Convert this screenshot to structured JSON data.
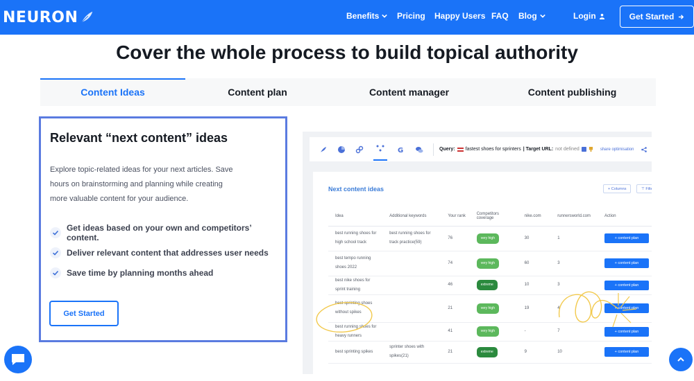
{
  "nav": {
    "logo": "NEURON",
    "links": [
      "Benefits",
      "Pricing",
      "Happy Users",
      "FAQ",
      "Blog"
    ],
    "login": "Login",
    "cta": "Get Started"
  },
  "heading": "Cover the whole process to build topical authority",
  "tabs": [
    "Content Ideas",
    "Content plan",
    "Content manager",
    "Content publishing"
  ],
  "card": {
    "title": "Relevant “next content” ideas",
    "desc_lines": [
      "Explore topic-related ideas for your next articles. Save",
      "hours on brainstorming and planning while creating",
      "more valuable content for your audience."
    ],
    "bullets": [
      "Get ideas based on your own and competitors’ content.",
      "Deliver relevant content that addresses user needs",
      "Save time by planning months ahead"
    ],
    "button": "Get Started"
  },
  "preview": {
    "toolbar": {
      "query_label": "Query:",
      "query_value": "fastest shoes for sprinters",
      "target_label": "| Target URL:",
      "target_value": "not defined",
      "share": "share optimisation"
    },
    "panel_title": "Next content ideas",
    "columns_btn": "+ Columns",
    "filters_btn": "⊤ Filters",
    "table": {
      "headers": [
        "Idea",
        "Additional keywords",
        "Your rank",
        "Competitors coverage",
        "nike.com",
        "runnersworld.com",
        "Action"
      ],
      "rows": [
        {
          "idea": "best running shoes for high school track",
          "keywords": "best running shoes for track practice(59)",
          "rank": "76",
          "coverage": "very high",
          "cov_type": "vh",
          "nike": "30",
          "rw": "1",
          "action": "+ content plan"
        },
        {
          "idea": "best tempo running shoes 2022",
          "keywords": "",
          "rank": "74",
          "coverage": "very high",
          "cov_type": "vh",
          "nike": "60",
          "rw": "3",
          "action": "+ content plan"
        },
        {
          "idea": "best nike shoes for sprint training",
          "keywords": "",
          "rank": "46",
          "coverage": "extreme",
          "cov_type": "ex",
          "nike": "10",
          "rw": "3",
          "action": "+ content plan"
        },
        {
          "idea": "best sprinting shoes without spikes",
          "keywords": "",
          "rank": "21",
          "coverage": "very high",
          "cov_type": "vh",
          "nike": "19",
          "rw": "4",
          "action": "+ content plan"
        },
        {
          "idea": "best running shoes for heavy runners",
          "keywords": "",
          "rank": "41",
          "coverage": "very high",
          "cov_type": "vh",
          "nike": "-",
          "rw": "7",
          "action": "+ content plan"
        },
        {
          "idea": "best sprinting spikes",
          "keywords": "sprinter shoes with spikes(21)",
          "rank": "21",
          "coverage": "extreme",
          "cov_type": "ex",
          "nike": "9",
          "rw": "10",
          "action": "+ content plan"
        }
      ]
    }
  },
  "colors": {
    "primary": "#1a73f8",
    "card_border": "#5a7be0",
    "highlight": "#f2c94c"
  }
}
